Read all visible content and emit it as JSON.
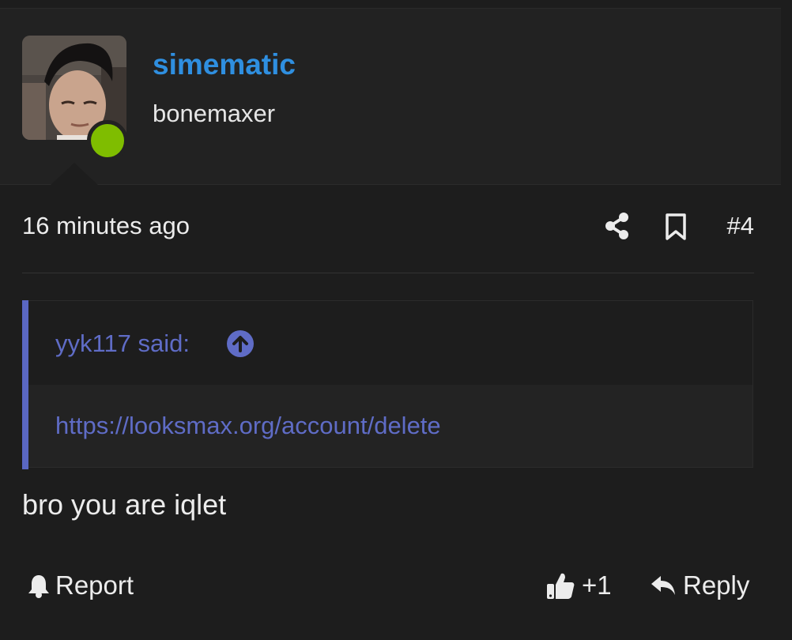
{
  "user": {
    "username": "simematic",
    "title": "bonemaxer",
    "online": true,
    "online_color": "#7fbd00",
    "username_color": "#2f8fe0",
    "avatar_icon": "user-avatar-photo"
  },
  "meta": {
    "timestamp": "16 minutes ago",
    "post_number": "#4",
    "share_icon": "share-icon",
    "bookmark_icon": "bookmark-icon"
  },
  "quote": {
    "author_said": "yyk117 said:",
    "link": "https://looksmax.org/account/delete",
    "accent_color": "#5a67c2",
    "jump_icon": "arrow-up-circle-icon"
  },
  "message": "bro you are iqlet",
  "actions": {
    "report_label": "Report",
    "report_icon": "bell-icon",
    "like_label": "+1",
    "like_icon": "thumbs-up-icon",
    "reply_label": "Reply",
    "reply_icon": "reply-arrow-icon"
  }
}
